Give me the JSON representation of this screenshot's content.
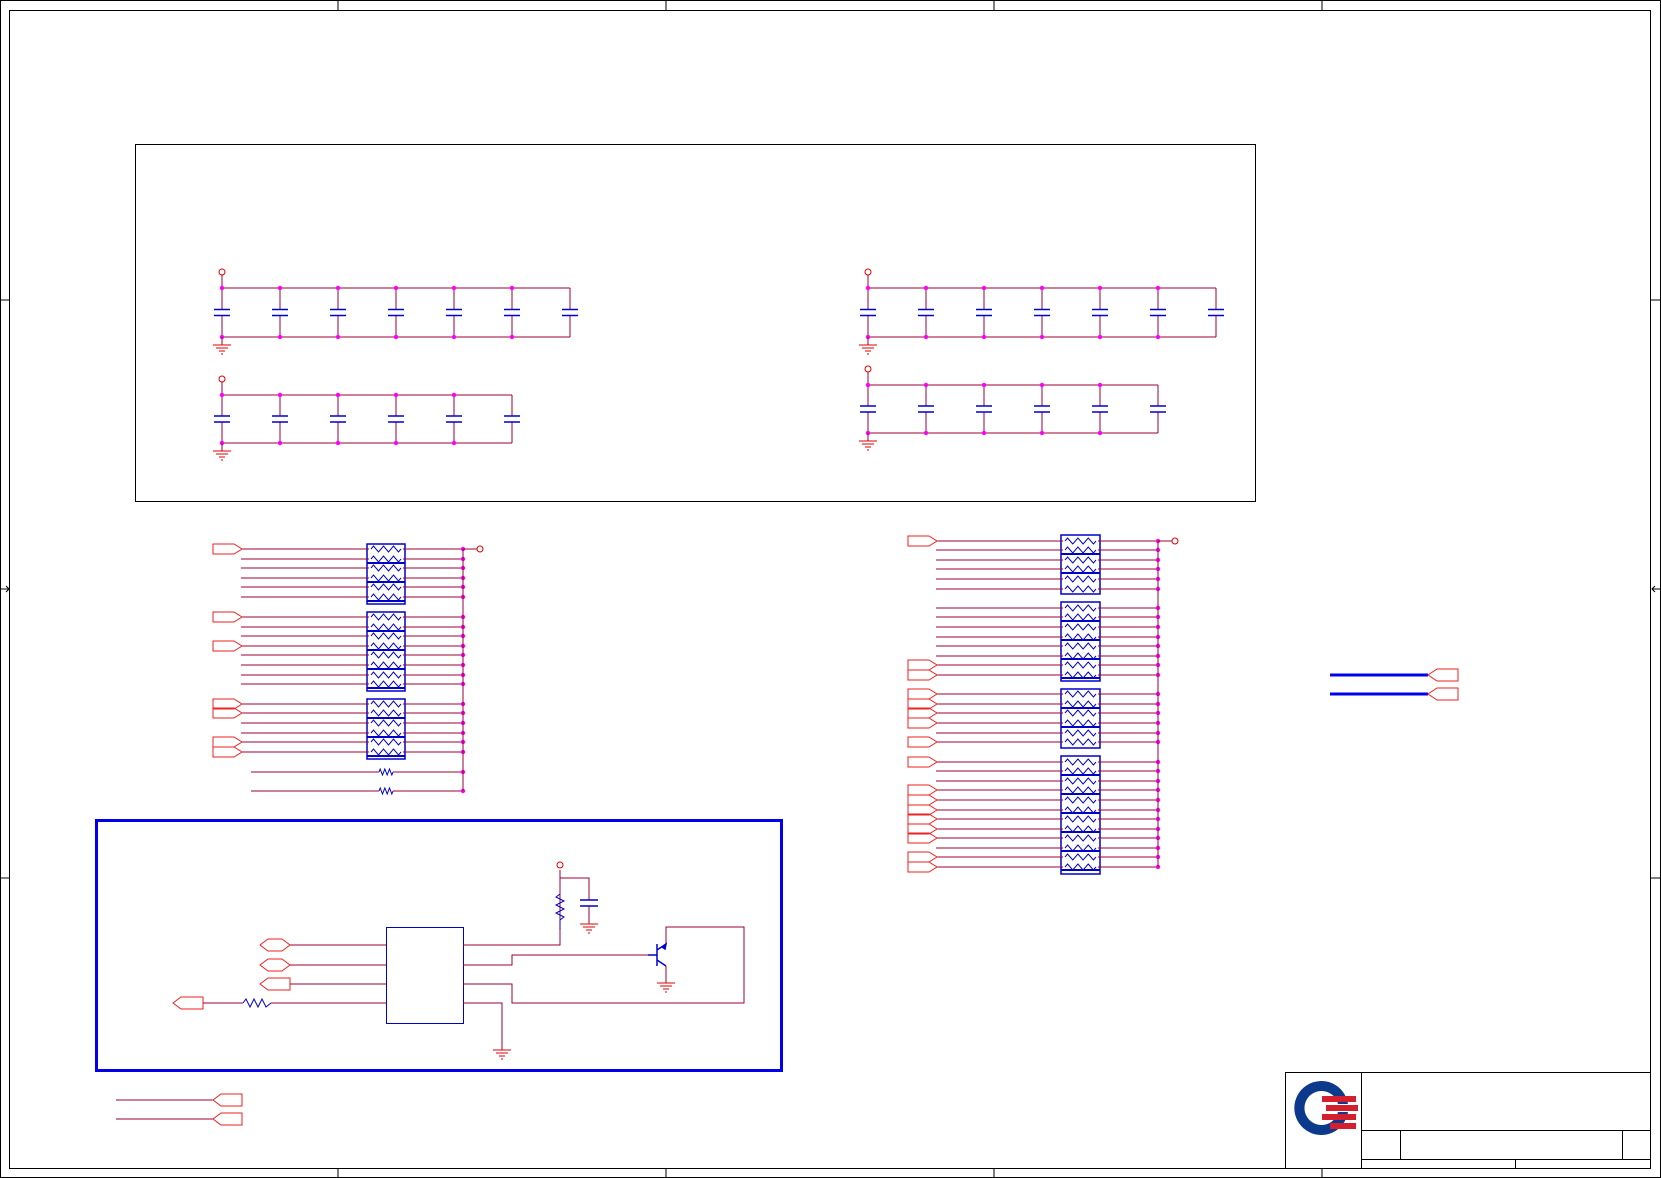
{
  "colors": {
    "border": "#000000",
    "net_wire": "#990033",
    "power_symbol": "#dd0000",
    "component": "#0000cc",
    "junction": "#ff00ff",
    "port": "#ee2222",
    "group_box": "#0000ee",
    "logo_blue": "#0b3a8c",
    "logo_red": "#d4202e"
  },
  "title_block": {
    "logo": "quanta-logo",
    "fields": []
  },
  "icons": {
    "logo": "company-logo",
    "ground": "ground-icon",
    "power": "power-icon",
    "capacitor": "capacitor-icon",
    "resistor": "resistor-icon",
    "resistor_pack": "resistor-pack-icon",
    "transistor": "npn-transistor-icon",
    "port": "net-port-icon"
  }
}
